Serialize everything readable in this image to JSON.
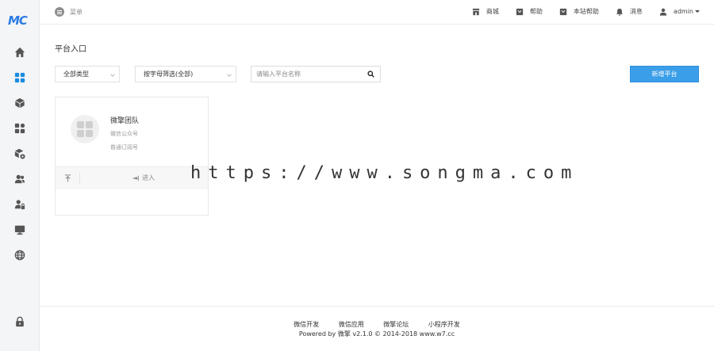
{
  "sidebar": {
    "logo": "MC",
    "items": [
      {
        "icon": "home-icon"
      },
      {
        "icon": "grid-icon",
        "active": true
      },
      {
        "icon": "cube-icon"
      },
      {
        "icon": "apps-icon"
      },
      {
        "icon": "module-gear-icon"
      },
      {
        "icon": "users-icon"
      },
      {
        "icon": "user-lock-icon"
      },
      {
        "icon": "monitor-icon"
      },
      {
        "icon": "globe-icon"
      },
      {
        "icon": "lock-icon"
      }
    ]
  },
  "header": {
    "menu_label": "菜单",
    "nav": {
      "shop": "商城",
      "help": "帮助",
      "site_help": "本站帮助",
      "messages": "消息",
      "user": "admin"
    }
  },
  "main": {
    "title": "平台入口",
    "filter_type": "全部类型",
    "filter_letter": "按字母筛选(全部)",
    "search_placeholder": "请输入平台名称",
    "new_button": "新增平台",
    "cards": [
      {
        "name": "微擎团队",
        "type": "微信公众号",
        "level": "普通订阅号",
        "enter": "进入"
      }
    ]
  },
  "watermark": "https://www.songma.com",
  "footer": {
    "links": [
      "微信开发",
      "微信应用",
      "微擎论坛",
      "小程序开发"
    ],
    "copyright": "Powered by 微擎 v2.1.0 © 2014-2018 www.w7.cc"
  },
  "colors": {
    "accent": "#1d8ce0",
    "button": "#3b9ee9"
  }
}
